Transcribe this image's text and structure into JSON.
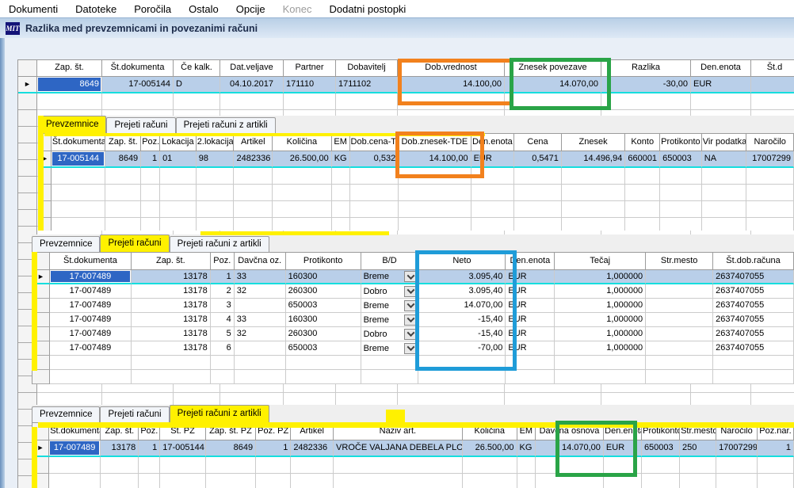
{
  "menu": {
    "items": [
      {
        "label": "Dokumenti",
        "enabled": true
      },
      {
        "label": "Datoteke",
        "enabled": true
      },
      {
        "label": "Poročila",
        "enabled": true
      },
      {
        "label": "Ostalo",
        "enabled": true
      },
      {
        "label": "Opcije",
        "enabled": true
      },
      {
        "label": "Konec",
        "enabled": false
      },
      {
        "label": "Dodatni postopki",
        "enabled": true
      }
    ]
  },
  "window": {
    "logo": "MIT",
    "title": "Razlika med prevzemnicami in povezanimi računi"
  },
  "main_table": {
    "columns": [
      "Zap. št.",
      "Št.dokumenta",
      "Če kalk.",
      "Dat.veljave",
      "Partner",
      "Dobavitelj",
      "Dob.vrednost",
      "Znesek povezave",
      "Razlika",
      "Den.enota",
      "Št.d"
    ],
    "rows": [
      [
        "8649",
        "17-005144",
        "D",
        "04.10.2017",
        "171110",
        "1711102",
        "14.100,00",
        "14.070,00",
        "-30,00",
        "EUR",
        ""
      ]
    ]
  },
  "panels": {
    "prevzemnice": {
      "tabs": [
        "Prevzemnice",
        "Prejeti računi",
        "Prejeti računi z artikli"
      ],
      "active_tab": "Prevzemnice",
      "columns": [
        "Št.dokumenta",
        "Zap. št.",
        "Poz.",
        "Lokacija",
        "2.lokacija",
        "Artikel",
        "Količina",
        "EM",
        "Dob.cena-TDI",
        "Dob.znesek-TDE",
        "Den.enota",
        "Cena",
        "Znesek",
        "Konto",
        "Protikonto",
        "Vir podatka",
        "Naročilo"
      ],
      "rows": [
        [
          "17-005144",
          "8649",
          "1",
          "01",
          "98",
          "2482336",
          "26.500,00",
          "KG",
          "0,532",
          "14.100,00",
          "EUR",
          "0,5471",
          "14.496,94",
          "660001",
          "650003",
          "NA",
          "17007299"
        ]
      ]
    },
    "prejeti_racuni": {
      "tabs": [
        "Prevzemnice",
        "Prejeti računi",
        "Prejeti računi z artikli"
      ],
      "active_tab": "Prejeti računi",
      "columns": [
        "Št.dokumenta",
        "Zap. št.",
        "Poz.",
        "Davčna oz.",
        "Protikonto",
        "B/D",
        "Neto",
        "Den.enota",
        "Tečaj",
        "Str.mesto",
        "Št.dob.računa"
      ],
      "rows": [
        [
          "17-007489",
          "13178",
          "1",
          "33",
          "160300",
          "Breme",
          "3.095,40",
          "EUR",
          "1,000000",
          "",
          "2637407055"
        ],
        [
          "17-007489",
          "13178",
          "2",
          "32",
          "260300",
          "Dobro",
          "3.095,40",
          "EUR",
          "1,000000",
          "",
          "2637407055"
        ],
        [
          "17-007489",
          "13178",
          "3",
          "",
          "650003",
          "Breme",
          "14.070,00",
          "EUR",
          "1,000000",
          "",
          "2637407055"
        ],
        [
          "17-007489",
          "13178",
          "4",
          "33",
          "160300",
          "Breme",
          "-15,40",
          "EUR",
          "1,000000",
          "",
          "2637407055"
        ],
        [
          "17-007489",
          "13178",
          "5",
          "32",
          "260300",
          "Dobro",
          "-15,40",
          "EUR",
          "1,000000",
          "",
          "2637407055"
        ],
        [
          "17-007489",
          "13178",
          "6",
          "",
          "650003",
          "Breme",
          "-70,00",
          "EUR",
          "1,000000",
          "",
          "2637407055"
        ]
      ]
    },
    "prejeti_racuni_artikli": {
      "tabs": [
        "Prevzemnice",
        "Prejeti računi",
        "Prejeti računi z artikli"
      ],
      "active_tab": "Prejeti računi z artikli",
      "columns": [
        "Št.dokumenta",
        "Zap. št.",
        "Poz.",
        "Št. PZ",
        "Zap. št. PZ",
        "Poz. PZ",
        "Artikel",
        "Naziv art.",
        "Količina",
        "EM",
        "Davčna osnova",
        "Den.enota",
        "Protikonto",
        "Str.mesto",
        "Naročilo",
        "Poz.nar."
      ],
      "rows": [
        [
          "17-007489",
          "13178",
          "1",
          "17-005144",
          "8649",
          "1",
          "2482336",
          "VROČE VALJANA DEBELA PLOČ",
          "26.500,00",
          "KG",
          "14.070,00",
          "EUR",
          "650003",
          "250",
          "17007299",
          "1"
        ]
      ]
    }
  },
  "annotations": {
    "orange": "#F2811D",
    "green": "#2AA447",
    "blue": "#1F9CD8",
    "yellow": "#FFF100"
  }
}
